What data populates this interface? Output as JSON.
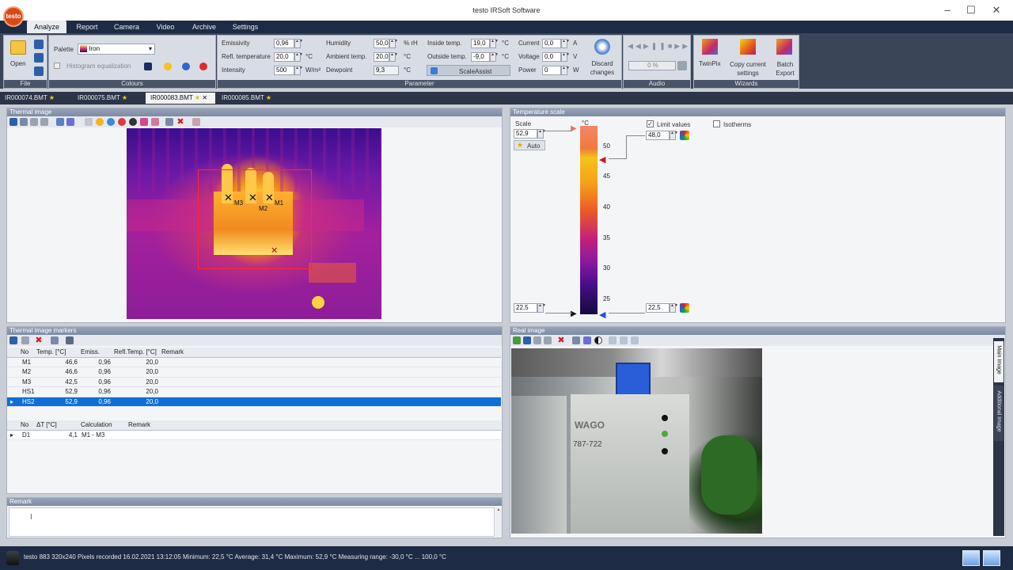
{
  "window": {
    "title": "testo IRSoft Software",
    "logo": "testo"
  },
  "menu": [
    "Analyze",
    "Report",
    "Camera",
    "Video",
    "Archive",
    "Settings"
  ],
  "ribbon": {
    "file": {
      "caption": "File",
      "open": "Open"
    },
    "colours": {
      "caption": "Colours",
      "palette_label": "Palette",
      "palette_value": "Iron",
      "histogram": "Histogram equalization"
    },
    "parameter": {
      "caption": "Parameter",
      "emissivity": {
        "label": "Emissivity",
        "value": "0,96"
      },
      "refl_temp": {
        "label": "Refl. temperature",
        "value": "20,0",
        "unit": "°C"
      },
      "intensity": {
        "label": "Intensity",
        "value": "500",
        "unit": "W/m²"
      },
      "humidity": {
        "label": "Humidity",
        "value": "50,0",
        "unit": "% rH"
      },
      "ambient": {
        "label": "Ambient temp.",
        "value": "20,0",
        "unit": "°C"
      },
      "dewpoint": {
        "label": "Dewpoint",
        "value": "9,3",
        "unit": "°C"
      },
      "inside": {
        "label": "Inside temp.",
        "value": "19,0",
        "unit": "°C"
      },
      "outside": {
        "label": "Outside temp.",
        "value": "-9,0",
        "unit": "°C"
      },
      "scaleassist": "ScaleAssist",
      "current": {
        "label": "Current",
        "value": "0,0",
        "unit": "A"
      },
      "voltage": {
        "label": "Voltage",
        "value": "0,0",
        "unit": "V"
      },
      "power": {
        "label": "Power",
        "value": "0",
        "unit": "W"
      },
      "discard": "Discard changes"
    },
    "audio": {
      "caption": "Audio",
      "percent": "0 %"
    },
    "wizards": {
      "caption": "Wizards",
      "twinpix": "TwinPix",
      "copy": "Copy current settings",
      "batch": "Batch Export"
    }
  },
  "doc_tabs": [
    "IR000074.BMT",
    "IR000075.BMT",
    "IR000083.BMT",
    "IR000085.BMT"
  ],
  "thermal_panel": {
    "title": "Thermal image",
    "markers": [
      "M3",
      "M2",
      "M1"
    ]
  },
  "scale_panel": {
    "title": "Temperature scale",
    "scale_label": "Scale",
    "scale_max": "52,9",
    "auto": "Auto",
    "unit": "°C",
    "ticks": [
      "50",
      "45",
      "40",
      "35",
      "30",
      "25"
    ],
    "scale_min": "22,5",
    "limit_label": "Limit values",
    "limit_upper": "48,0",
    "limit_lower": "22,5",
    "isotherms": "Isotherms"
  },
  "markers_panel": {
    "title": "Thermal image markers",
    "columns": [
      "No",
      "Temp. [°C]",
      "Emiss.",
      "Refl.Temp. [°C]",
      "Remark"
    ],
    "rows": [
      [
        "M1",
        "46,6",
        "0,96",
        "20,0",
        ""
      ],
      [
        "M2",
        "46,6",
        "0,96",
        "20,0",
        ""
      ],
      [
        "M3",
        "42,5",
        "0,96",
        "20,0",
        ""
      ],
      [
        "HS1",
        "52,9",
        "0,96",
        "20,0",
        ""
      ],
      [
        "HS2",
        "52,9",
        "0,96",
        "20,0",
        ""
      ]
    ],
    "diff_columns": [
      "No",
      "ΔT [°C]",
      "Calculation",
      "Remark"
    ],
    "diff_rows": [
      [
        "D1",
        "4,1",
        "M1 - M3",
        ""
      ]
    ]
  },
  "remark_panel": {
    "title": "Remark"
  },
  "real_panel": {
    "title": "Real image",
    "side_tabs": [
      "Main Image",
      "Additional Image"
    ],
    "photo_text": {
      "brand": "WAGO",
      "model": "787-722"
    }
  },
  "status": "testo 883  320x240  Pixels recorded  16.02.2021 13:12:05  Minimum: 22,5 °C  Average: 31,4 °C  Maximum: 52,9 °C  Measuring range: -30,0 °C ... 100,0 °C"
}
